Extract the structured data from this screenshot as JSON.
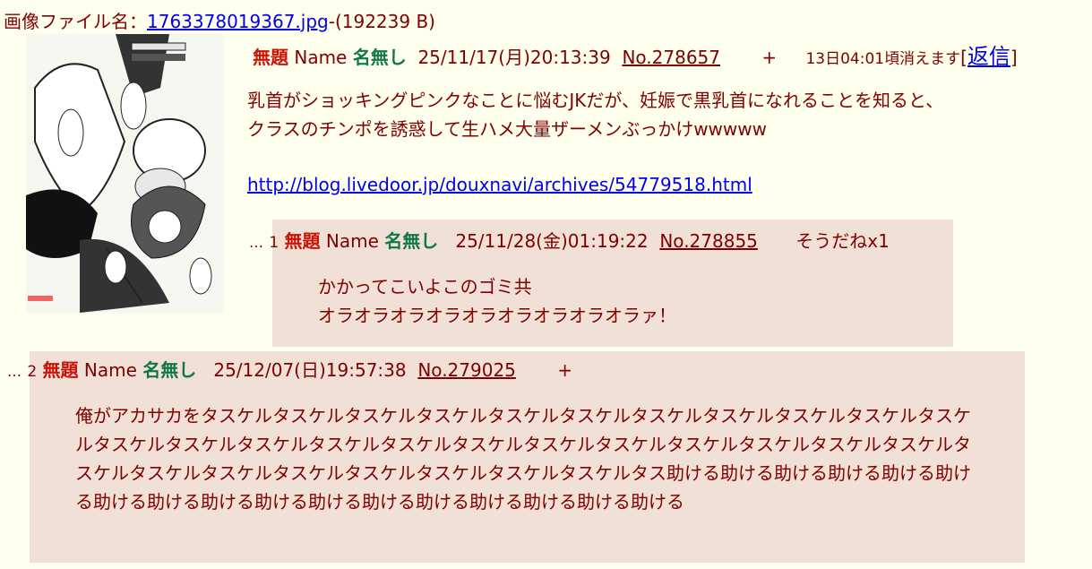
{
  "file": {
    "prefix": "画像ファイル名：",
    "name": "1763378019367.jpg",
    "size": "-(192239 B)"
  },
  "op": {
    "subject": "無題",
    "name_label": "Name",
    "name": "名無し",
    "date": "25/11/17(月)20:13:39",
    "no": "No.278657",
    "plus": "+",
    "expire": "13日04:01頃消えます",
    "bracket_open": "[",
    "reply": "返信",
    "bracket_close": "]",
    "body": "乳首がショッキングピンクなことに悩むJKだが、妊娠で黒乳首になれることを知ると、クラスのチンポを誘惑して生ハメ大量ザーメンぶっかけwwwww",
    "url": "http://blog.livedoor.jp/douxnavi/archives/54779518.html"
  },
  "replies": [
    {
      "dots": "…",
      "num": "1",
      "subject": "無題",
      "name_label": "Name",
      "name": "名無し",
      "date": "25/11/28(金)01:19:22",
      "no": "No.278855",
      "soudane": "そうだねx1",
      "lines": [
        "かかってこいよこのゴミ共",
        "オラオラオラオラオラオラオラオラオラァ！"
      ]
    },
    {
      "dots": "…",
      "num": "2",
      "subject": "無題",
      "name_label": "Name",
      "name": "名無し",
      "date": "25/12/07(日)19:57:38",
      "no": "No.279025",
      "plus": "+",
      "body": "俺がアカサカをタスケルタスケルタスケルタスケルタスケルタスケルタスケルタスケルタスケルタスケルタスケルタスケルタスケルタスケルタスケルタスケルタスケルタスケルタスケルタスケルタスケルタスケルタスケルタスケルタスケルタスケルタスケルタスケルタスケルタスケルタスケルタス助ける助ける助ける助ける助ける助ける助ける助ける助ける助ける助ける助ける助ける助ける助ける助ける助ける"
    }
  ]
}
